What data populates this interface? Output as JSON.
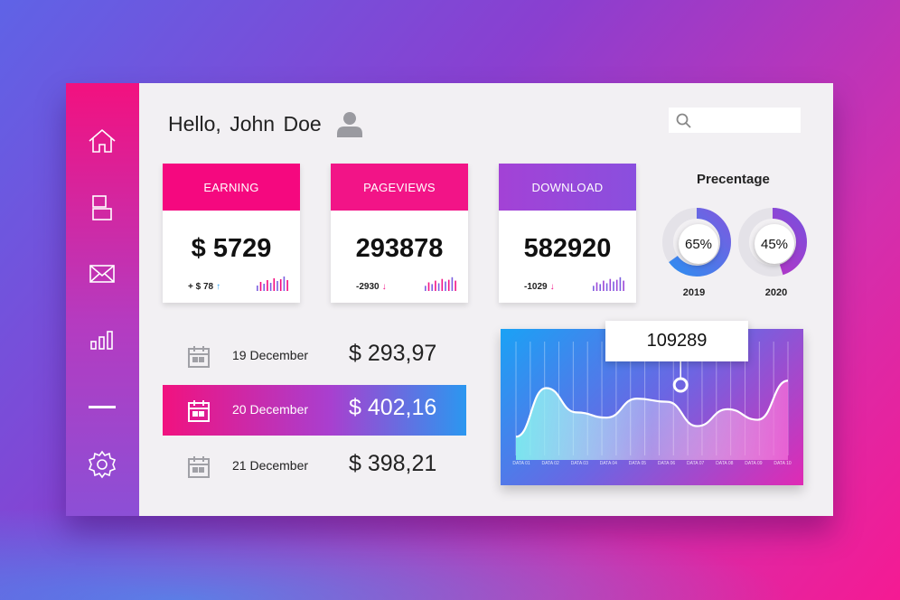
{
  "header": {
    "greeting": "Hello, John  Doe",
    "search_placeholder": ""
  },
  "sidebar": {
    "items": [
      {
        "icon": "home-icon"
      },
      {
        "icon": "documents-icon"
      },
      {
        "icon": "mail-icon"
      },
      {
        "icon": "bar-chart-icon"
      },
      {
        "icon": "minus-icon"
      },
      {
        "icon": "gear-icon"
      }
    ]
  },
  "cards": [
    {
      "title": "EARNING",
      "value": "$ 5729",
      "change": "+ $ 78",
      "direction": "up",
      "accent": "#f5087f"
    },
    {
      "title": "PAGEVIEWS",
      "value": "293878",
      "change": "-2930",
      "direction": "down",
      "accent": "#f21487"
    },
    {
      "title": "DOWNLOAD",
      "value": "582920",
      "change": "-1029",
      "direction": "down",
      "accent": "#9b47d8"
    }
  ],
  "percentage": {
    "title": "Precentage",
    "items": [
      {
        "label": "65%",
        "year": "2019",
        "value": 65
      },
      {
        "label": "45%",
        "year": "2020",
        "value": 45
      }
    ]
  },
  "transactions": [
    {
      "date": "19 December",
      "amount": "$ 293,97",
      "selected": false
    },
    {
      "date": "20 December",
      "amount": "$ 402,16",
      "selected": true
    },
    {
      "date": "21 December",
      "amount": "$ 398,21",
      "selected": false
    }
  ],
  "chart_data": {
    "type": "area",
    "categories": [
      "DATA 01",
      "DATA 02",
      "DATA 03",
      "DATA 04",
      "DATA 05",
      "DATA 06",
      "DATA 07",
      "DATA 08",
      "DATA 09",
      "DATA 10"
    ],
    "values": [
      22,
      68,
      45,
      40,
      58,
      55,
      32,
      48,
      38,
      75
    ],
    "highlight": {
      "category": "DATA 06",
      "label": "109289"
    },
    "colors": {
      "start": "#1aa2f5",
      "end": "#e02ab4"
    }
  }
}
